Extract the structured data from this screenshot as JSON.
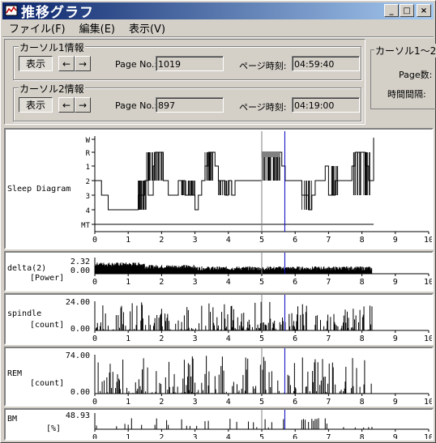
{
  "window": {
    "title": "推移グラフ",
    "buttons": {
      "minimize": "_",
      "maximize": "□",
      "close": "×"
    }
  },
  "menu": [
    {
      "label": "ファイル(F)"
    },
    {
      "label": "編集(E)"
    },
    {
      "label": "表示(V)"
    }
  ],
  "cursor1": {
    "title": "カーソル1情報",
    "show_label": "表示",
    "left_label": "←",
    "right_label": "→",
    "page_no_label": "Page No.:",
    "page_no_value": "1019",
    "page_time_label": "ページ時刻:",
    "page_time_value": "04:59:40"
  },
  "cursor2": {
    "title": "カーソル2情報",
    "show_label": "表示",
    "left_label": "←",
    "right_label": "→",
    "page_no_label": "Page No.:",
    "page_no_value": "897",
    "page_time_label": "ページ時刻:",
    "page_time_value": "04:19:00"
  },
  "cursor_diff": {
    "title": "カーソル1〜2",
    "page_count_label": "Page数:",
    "interval_label": "時間間隔:"
  },
  "x_ticks": [
    "0",
    "1",
    "2",
    "3",
    "4",
    "5",
    "6",
    "7",
    "8",
    "9",
    "10"
  ],
  "cursor_positions": {
    "cursor1_hours": 5.69,
    "cursor2_hours": 5.0
  },
  "charts": {
    "sleep": {
      "title": "Sleep Diagram",
      "levels": [
        "W",
        "R",
        "1",
        "2",
        "3",
        "4",
        "MT"
      ]
    },
    "delta": {
      "name": "delta(2)",
      "unit": "[Power]",
      "ymax": "2.32",
      "ymin": "0.00"
    },
    "spindle": {
      "name": "spindle",
      "unit": "[count]",
      "ymax": "24.00",
      "ymin": "0.00"
    },
    "rem": {
      "name": "REM",
      "unit": "[count]",
      "ymax": "74.00",
      "ymin": "0.00"
    },
    "bm": {
      "name": "BM",
      "unit": "[%]",
      "ymax": "48.93"
    }
  },
  "colors": {
    "titlebar_start": "#0a246a",
    "titlebar_end": "#a6caf0",
    "cursor1_line": "#0000c0",
    "cursor2_line": "#808080"
  },
  "chart_data": {
    "type": "line",
    "title": "Sleep Diagram",
    "x_range": [
      0,
      10
    ],
    "x_ticks": [
      0,
      1,
      2,
      3,
      4,
      5,
      6,
      7,
      8,
      9,
      10
    ],
    "series": [
      {
        "name": "Sleep Diagram",
        "points": [
          [
            0,
            2
          ],
          [
            0.15,
            2
          ],
          [
            0.2,
            3
          ],
          [
            0.35,
            3
          ],
          [
            0.4,
            4
          ],
          [
            0.55,
            4
          ],
          [
            0.6,
            4
          ],
          [
            1.0,
            4
          ],
          [
            1.2,
            4
          ],
          [
            1.3,
            3
          ],
          [
            1.5,
            2
          ],
          [
            1.6,
            3
          ],
          [
            1.75,
            1
          ],
          [
            1.8,
            -1
          ],
          [
            2.0,
            -1
          ],
          [
            2.05,
            2
          ],
          [
            2.2,
            3
          ],
          [
            2.3,
            3
          ],
          [
            2.5,
            2
          ],
          [
            2.7,
            3
          ],
          [
            2.9,
            3
          ],
          [
            3.0,
            4
          ],
          [
            3.1,
            3
          ],
          [
            3.2,
            2
          ],
          [
            3.3,
            1
          ],
          [
            3.4,
            -1
          ],
          [
            3.5,
            -1
          ],
          [
            3.6,
            1
          ],
          [
            3.7,
            2
          ],
          [
            3.8,
            2
          ],
          [
            3.9,
            3
          ],
          [
            4.0,
            2
          ],
          [
            4.1,
            3
          ],
          [
            4.2,
            2
          ],
          [
            4.5,
            2
          ],
          [
            4.8,
            2
          ],
          [
            4.95,
            2
          ],
          [
            5.0,
            -1
          ],
          [
            5.1,
            -1
          ],
          [
            5.5,
            -1
          ],
          [
            5.6,
            1
          ],
          [
            5.7,
            2
          ],
          [
            6.0,
            2
          ],
          [
            6.2,
            3
          ],
          [
            6.4,
            4
          ],
          [
            6.5,
            3
          ],
          [
            6.6,
            2
          ],
          [
            6.9,
            1
          ],
          [
            7.0,
            3
          ],
          [
            7.2,
            2
          ],
          [
            7.5,
            2
          ],
          [
            7.7,
            1
          ],
          [
            7.8,
            -1
          ],
          [
            8.0,
            -1
          ],
          [
            8.1,
            1
          ],
          [
            8.2,
            2
          ],
          [
            8.3,
            2
          ],
          [
            8.35,
            -2
          ]
        ]
      }
    ],
    "delta_ymax": 2.32,
    "spindle_ymax": 24.0,
    "rem_ymax": 74.0,
    "bm_ymax": 48.93
  }
}
